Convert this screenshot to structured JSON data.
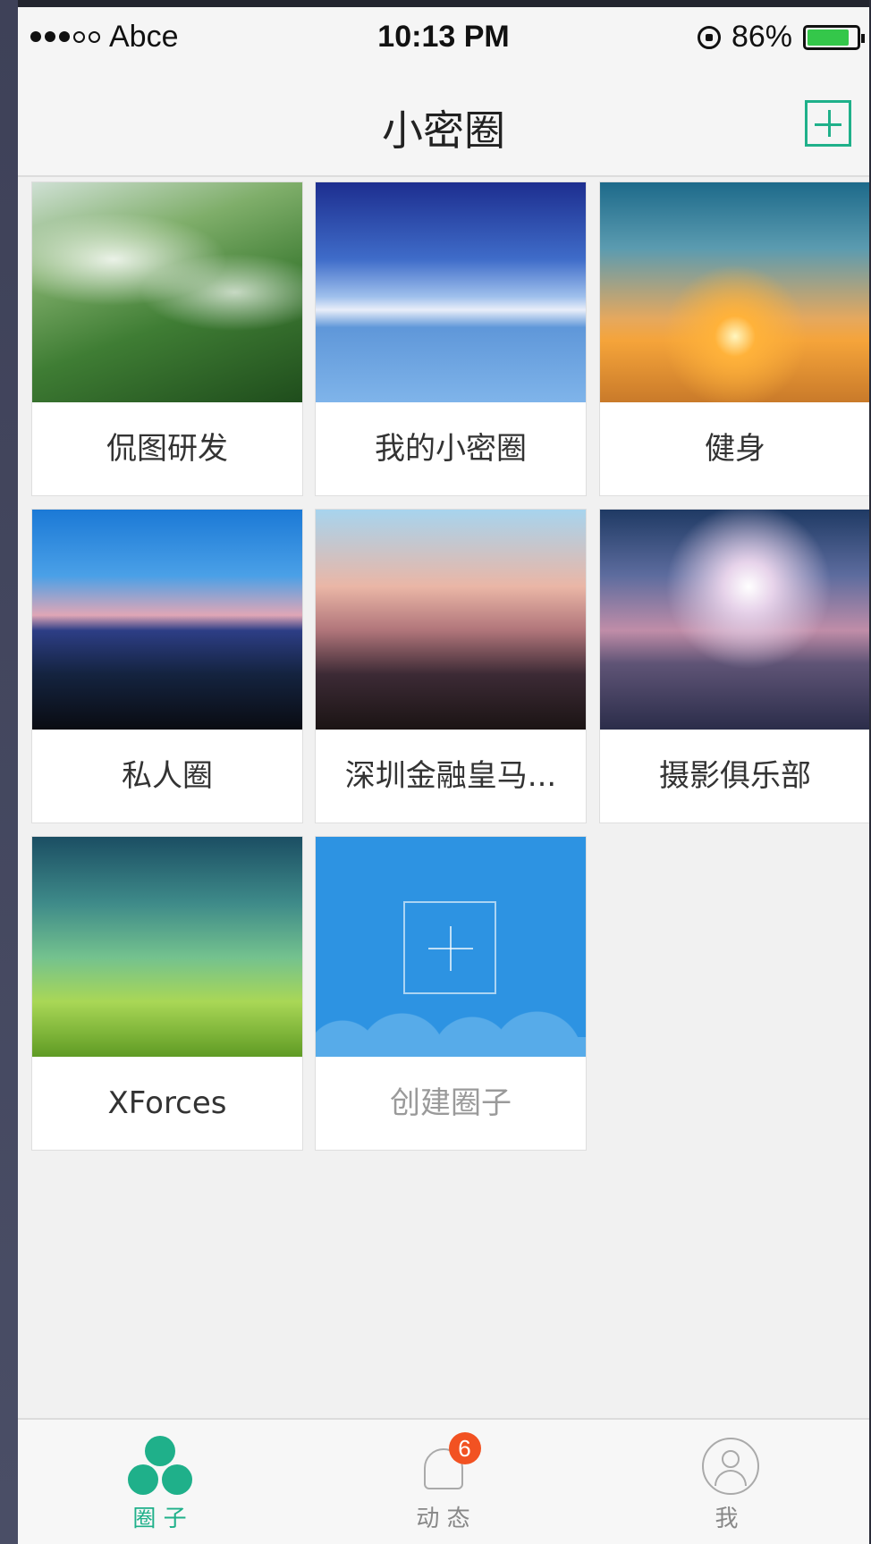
{
  "statusbar": {
    "carrier": "Abce",
    "time": "10:13 PM",
    "battery": "86%",
    "battery_level": 0.86
  },
  "navbar": {
    "title": "小密圈",
    "add_icon": "plus-square-icon"
  },
  "circles": [
    {
      "name": "侃图研发",
      "image": "mountain-mist"
    },
    {
      "name": "我的小密圈",
      "image": "sea-sky"
    },
    {
      "name": "健身",
      "image": "sunset-sea"
    },
    {
      "name": "私人圈",
      "image": "dusk-boats"
    },
    {
      "name": "深圳金融皇马...",
      "image": "city-skyline"
    },
    {
      "name": "摄影俱乐部",
      "image": "sun-rays"
    },
    {
      "name": "XForces",
      "image": "green-meadow"
    }
  ],
  "create_card": {
    "label": "创建圈子",
    "icon": "plus-icon"
  },
  "tabbar": {
    "tabs": [
      {
        "label": "圈 子",
        "icon": "circles-icon",
        "active": true
      },
      {
        "label": "动 态",
        "icon": "bell-icon",
        "badge": "6"
      },
      {
        "label": "我",
        "icon": "profile-icon"
      }
    ]
  },
  "colors": {
    "accent": "#1fb08a",
    "badge": "#f25222",
    "create_card": "#2d93e2"
  }
}
